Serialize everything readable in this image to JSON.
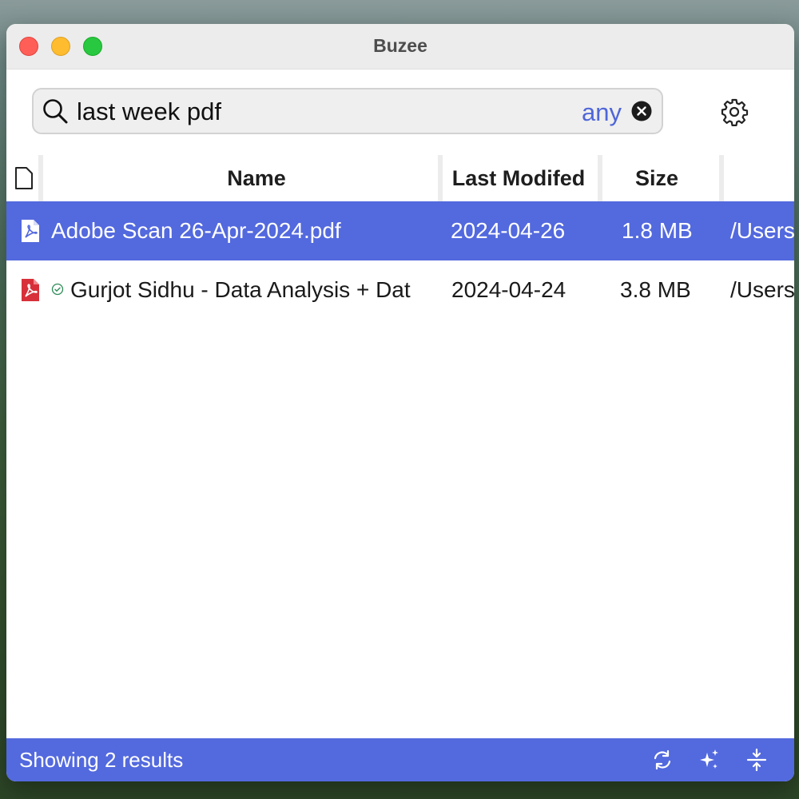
{
  "window": {
    "title": "Buzee"
  },
  "search": {
    "query": "last week pdf",
    "scope": "any"
  },
  "table": {
    "columns": [
      "Name",
      "Last Modifed",
      "Size"
    ],
    "rows": [
      {
        "name": "Adobe Scan 26-Apr-2024.pdf",
        "modified": "2024-04-26",
        "size": "1.8 MB",
        "path": "/Users",
        "selected": true
      },
      {
        "name": "Gurjot Sidhu - Data Analysis + Dat",
        "modified": "2024-04-24",
        "size": "3.8 MB",
        "path": "/Users",
        "selected": false
      }
    ]
  },
  "status": {
    "text": "Showing 2 results"
  },
  "icons": [
    "search-icon",
    "clear-icon",
    "gear-icon",
    "file-icon",
    "pdf-icon",
    "check-icon",
    "refresh-icon",
    "sparkle-icon",
    "collapse-icon"
  ],
  "colors": {
    "accent": "#5369de",
    "scope": "#4f66d8",
    "pdf": "#d7303a"
  }
}
